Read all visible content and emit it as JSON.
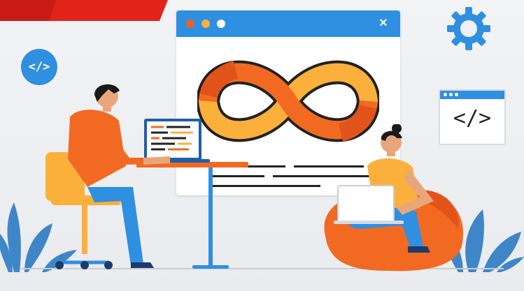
{
  "badge": {
    "code_label": "</>"
  },
  "mini_window": {
    "code_label": "</>"
  },
  "browser": {
    "close_label": "×"
  },
  "icons": {
    "gear": "gear-icon",
    "close": "close-icon",
    "infinity": "infinity-loop-icon",
    "code": "code-icon"
  },
  "colors": {
    "accent_blue": "#2f8fe0",
    "red": "#e2231a",
    "orange": "#f26a21",
    "yellow": "#fbb03b",
    "dark": "#222222"
  }
}
